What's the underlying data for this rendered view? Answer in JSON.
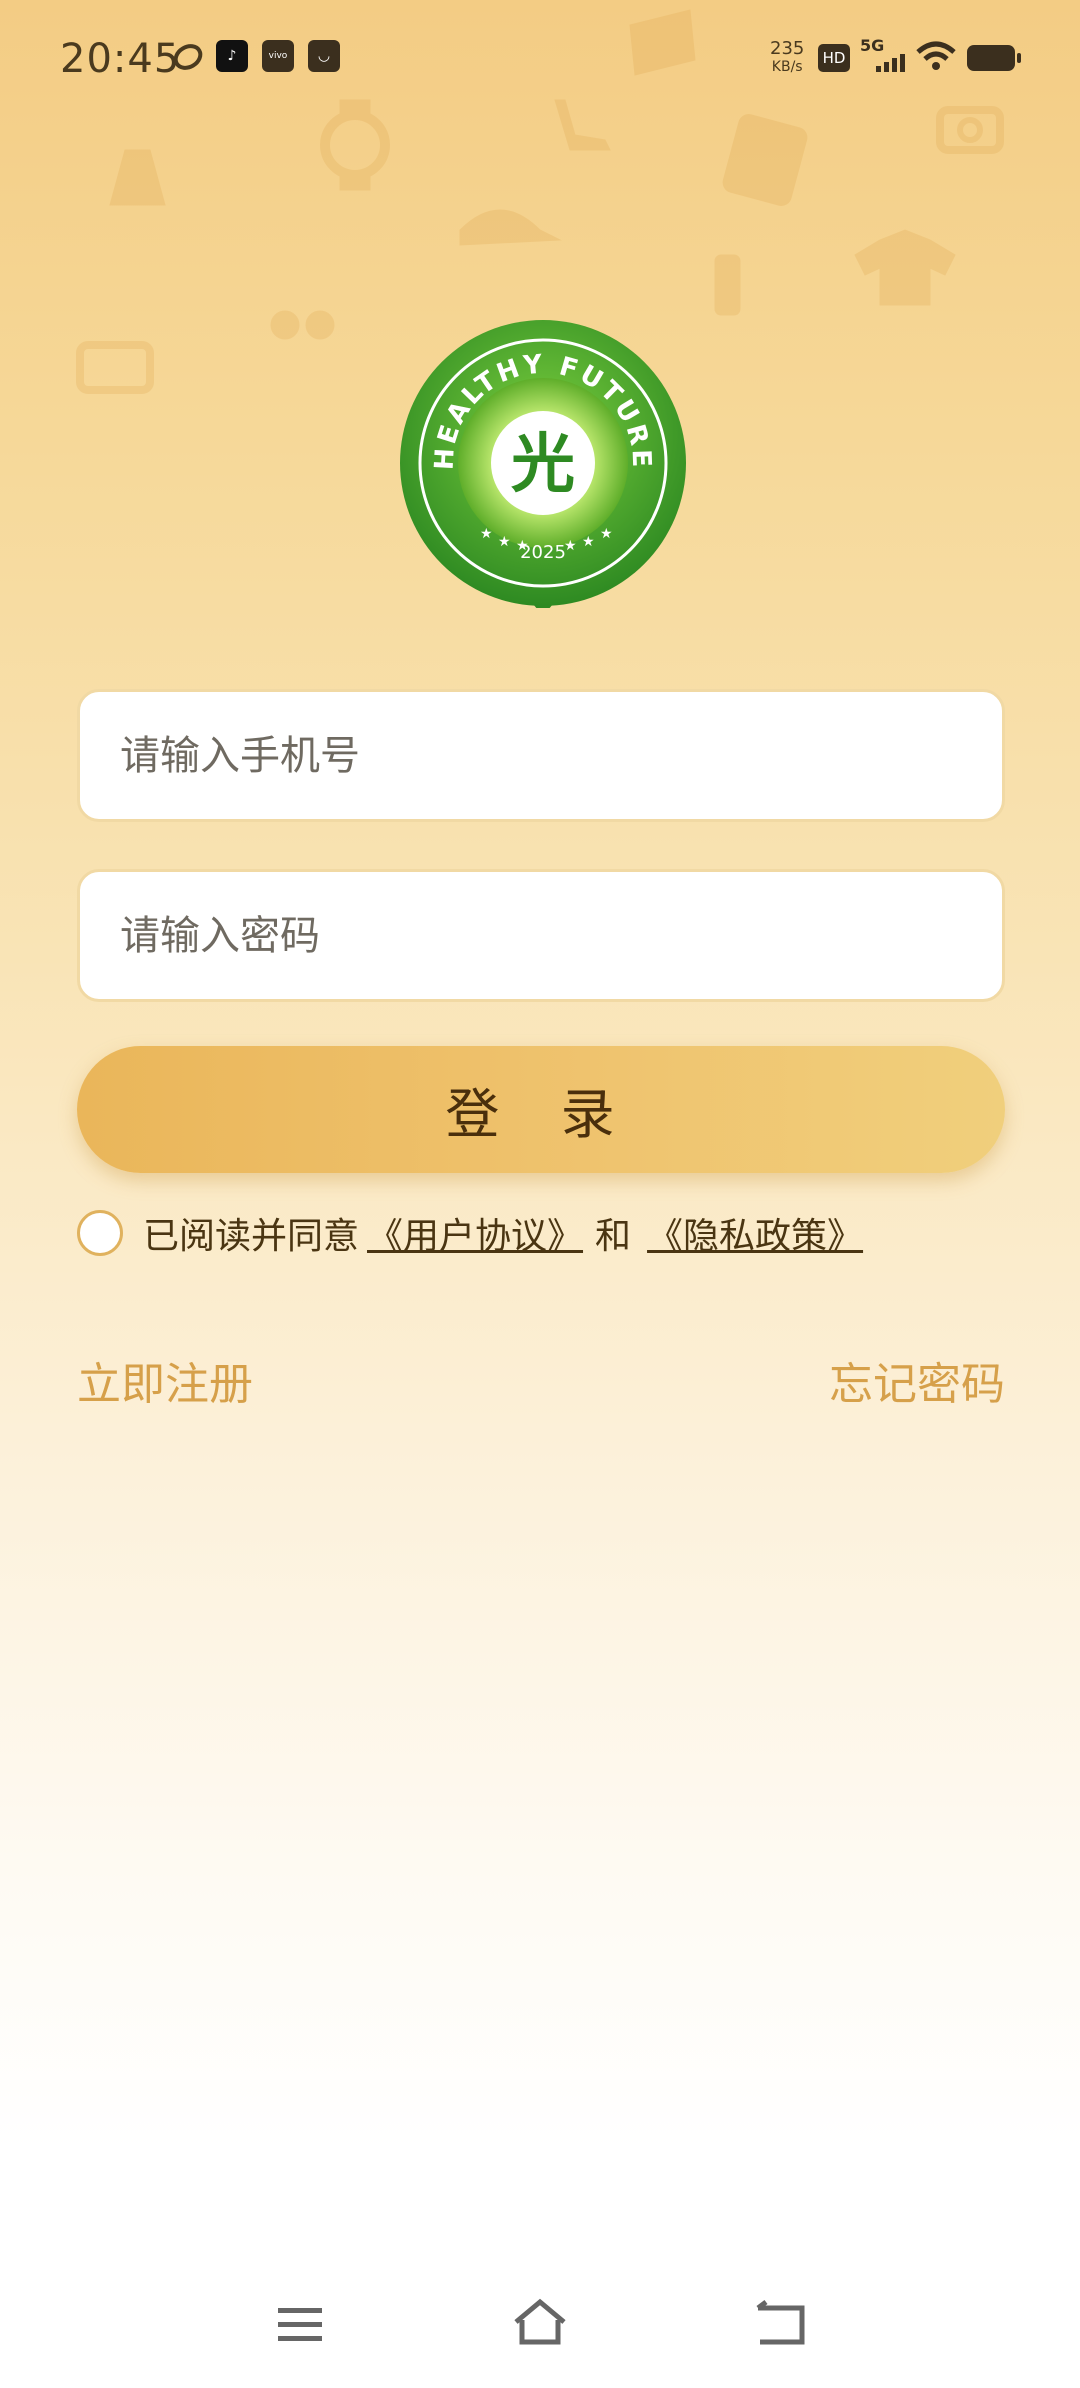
{
  "status_bar": {
    "time": "20:45",
    "speed_value": "235",
    "speed_unit": "KB/s",
    "hd": "HD",
    "network": "5G"
  },
  "logo": {
    "ring_text": "HEALTHY FUTURE",
    "center_char": "光",
    "year": "2025"
  },
  "form": {
    "phone_placeholder": "请输入手机号",
    "password_placeholder": "请输入密码",
    "login_label": "登 录"
  },
  "agreement": {
    "prefix": "已阅读并同意",
    "user_agreement": "《用户协议》",
    "and": "和",
    "privacy_policy": "《隐私政策》"
  },
  "links": {
    "register": "立即注册",
    "forgot": "忘记密码"
  },
  "colors": {
    "accent": "#d6a04a",
    "button": "#efc36e",
    "logo_green": "#3f9a2a"
  }
}
